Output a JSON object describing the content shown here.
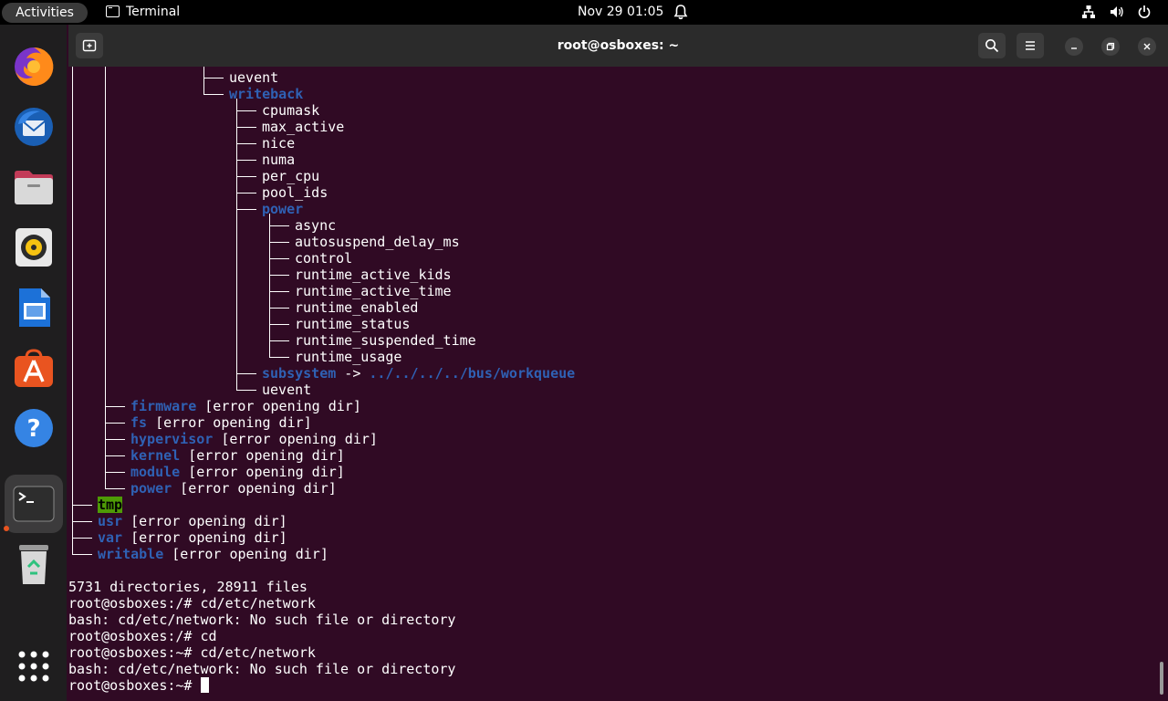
{
  "topbar": {
    "activities": "Activities",
    "app_name": "Terminal",
    "clock": "Nov 29  01:05"
  },
  "dock": {
    "items": [
      "firefox",
      "thunderbird",
      "files",
      "rhythmbox",
      "libreoffice-writer",
      "app-center",
      "help",
      "terminal",
      "trash",
      "show-apps"
    ],
    "active": "terminal"
  },
  "window": {
    "title": "root@osboxes: ~"
  },
  "terminal": {
    "tree": [
      {
        "indent": 5,
        "name": "uevent",
        "dir": false
      },
      {
        "indent": 5,
        "name": "writeback",
        "dir": true
      },
      {
        "indent": 6,
        "name": "cpumask",
        "dir": false
      },
      {
        "indent": 6,
        "name": "max_active",
        "dir": false
      },
      {
        "indent": 6,
        "name": "nice",
        "dir": false
      },
      {
        "indent": 6,
        "name": "numa",
        "dir": false
      },
      {
        "indent": 6,
        "name": "per_cpu",
        "dir": false
      },
      {
        "indent": 6,
        "name": "pool_ids",
        "dir": false
      },
      {
        "indent": 6,
        "name": "power",
        "dir": true
      },
      {
        "indent": 7,
        "name": "async",
        "dir": false
      },
      {
        "indent": 7,
        "name": "autosuspend_delay_ms",
        "dir": false
      },
      {
        "indent": 7,
        "name": "control",
        "dir": false
      },
      {
        "indent": 7,
        "name": "runtime_active_kids",
        "dir": false
      },
      {
        "indent": 7,
        "name": "runtime_active_time",
        "dir": false
      },
      {
        "indent": 7,
        "name": "runtime_enabled",
        "dir": false
      },
      {
        "indent": 7,
        "name": "runtime_status",
        "dir": false
      },
      {
        "indent": 7,
        "name": "runtime_suspended_time",
        "dir": false
      },
      {
        "indent": 7,
        "name": "runtime_usage",
        "dir": false
      },
      {
        "indent": 6,
        "name": "subsystem",
        "dir": true,
        "arrow": " -> ",
        "target": "../../../../bus/workqueue"
      },
      {
        "indent": 6,
        "name": "uevent",
        "dir": false
      },
      {
        "indent": 2,
        "name": "firmware",
        "dir": true,
        "suffix": " [error opening dir]"
      },
      {
        "indent": 2,
        "name": "fs",
        "dir": true,
        "suffix": " [error opening dir]"
      },
      {
        "indent": 2,
        "name": "hypervisor",
        "dir": true,
        "suffix": " [error opening dir]"
      },
      {
        "indent": 2,
        "name": "kernel",
        "dir": true,
        "suffix": " [error opening dir]"
      },
      {
        "indent": 2,
        "name": "module",
        "dir": true,
        "suffix": " [error opening dir]"
      },
      {
        "indent": 2,
        "name": "power",
        "dir": true,
        "suffix": " [error opening dir]"
      },
      {
        "indent": 1,
        "name": "tmp",
        "dir": true,
        "highlight": true
      },
      {
        "indent": 1,
        "name": "usr",
        "dir": true,
        "suffix": " [error opening dir]"
      },
      {
        "indent": 1,
        "name": "var",
        "dir": true,
        "suffix": " [error opening dir]"
      },
      {
        "indent": 1,
        "name": "writable",
        "dir": true,
        "suffix": " [error opening dir]"
      }
    ],
    "lines": [
      "",
      "5731 directories, 28911 files",
      "root@osboxes:/# cd/etc/network",
      "bash: cd/etc/network: No such file or directory",
      "root@osboxes:/# cd",
      "root@osboxes:~# cd/etc/network",
      "bash: cd/etc/network: No such file or directory"
    ],
    "prompt": "root@osboxes:~# "
  }
}
